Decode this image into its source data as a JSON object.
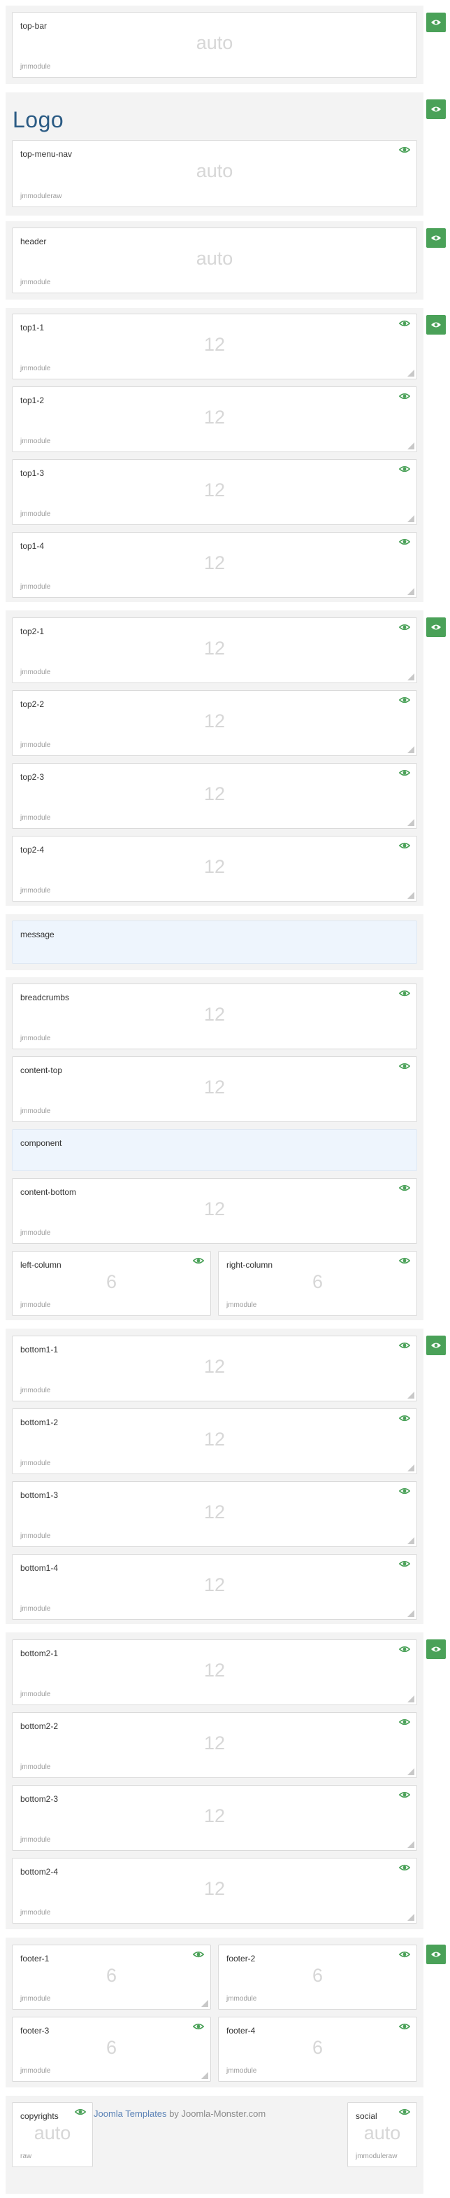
{
  "logo": "Logo",
  "credit": {
    "link_text": "Joomla Templates",
    "rest": " by Joomla-Monster.com"
  },
  "icons": {
    "visibility_icon": "eye-icon",
    "resize_handle": "resize-handle-icon"
  },
  "colors": {
    "accent_green": "#4aa158",
    "logo_blue": "#2b5b84",
    "card_blue": "#eef5fd"
  },
  "positions": {
    "top_bar": {
      "name": "top-bar",
      "size": "auto",
      "style": "jmmodule"
    },
    "top_menu_nav": {
      "name": "top-menu-nav",
      "size": "auto",
      "style": "jmmoduleraw"
    },
    "header": {
      "name": "header",
      "size": "auto",
      "style": "jmmodule"
    },
    "top1_1": {
      "name": "top1-1",
      "size": "12",
      "style": "jmmodule"
    },
    "top1_2": {
      "name": "top1-2",
      "size": "12",
      "style": "jmmodule"
    },
    "top1_3": {
      "name": "top1-3",
      "size": "12",
      "style": "jmmodule"
    },
    "top1_4": {
      "name": "top1-4",
      "size": "12",
      "style": "jmmodule"
    },
    "top2_1": {
      "name": "top2-1",
      "size": "12",
      "style": "jmmodule"
    },
    "top2_2": {
      "name": "top2-2",
      "size": "12",
      "style": "jmmodule"
    },
    "top2_3": {
      "name": "top2-3",
      "size": "12",
      "style": "jmmodule"
    },
    "top2_4": {
      "name": "top2-4",
      "size": "12",
      "style": "jmmodule"
    },
    "message": {
      "name": "message"
    },
    "breadcrumbs": {
      "name": "breadcrumbs",
      "size": "12",
      "style": "jmmodule"
    },
    "content_top": {
      "name": "content-top",
      "size": "12",
      "style": "jmmodule"
    },
    "component": {
      "name": "component"
    },
    "content_bottom": {
      "name": "content-bottom",
      "size": "12",
      "style": "jmmodule"
    },
    "left_column": {
      "name": "left-column",
      "size": "6",
      "style": "jmmodule"
    },
    "right_column": {
      "name": "right-column",
      "size": "6",
      "style": "jmmodule"
    },
    "bottom1_1": {
      "name": "bottom1-1",
      "size": "12",
      "style": "jmmodule"
    },
    "bottom1_2": {
      "name": "bottom1-2",
      "size": "12",
      "style": "jmmodule"
    },
    "bottom1_3": {
      "name": "bottom1-3",
      "size": "12",
      "style": "jmmodule"
    },
    "bottom1_4": {
      "name": "bottom1-4",
      "size": "12",
      "style": "jmmodule"
    },
    "bottom2_1": {
      "name": "bottom2-1",
      "size": "12",
      "style": "jmmodule"
    },
    "bottom2_2": {
      "name": "bottom2-2",
      "size": "12",
      "style": "jmmodule"
    },
    "bottom2_3": {
      "name": "bottom2-3",
      "size": "12",
      "style": "jmmodule"
    },
    "bottom2_4": {
      "name": "bottom2-4",
      "size": "12",
      "style": "jmmodule"
    },
    "footer_1": {
      "name": "footer-1",
      "size": "6",
      "style": "jmmodule"
    },
    "footer_2": {
      "name": "footer-2",
      "size": "6",
      "style": "jmmodule"
    },
    "footer_3": {
      "name": "footer-3",
      "size": "6",
      "style": "jmmodule"
    },
    "footer_4": {
      "name": "footer-4",
      "size": "6",
      "style": "jmmodule"
    },
    "copyrights": {
      "name": "copyrights",
      "size": "auto",
      "style": "raw"
    },
    "social": {
      "name": "social",
      "size": "auto",
      "style": "jmmoduleraw"
    }
  }
}
